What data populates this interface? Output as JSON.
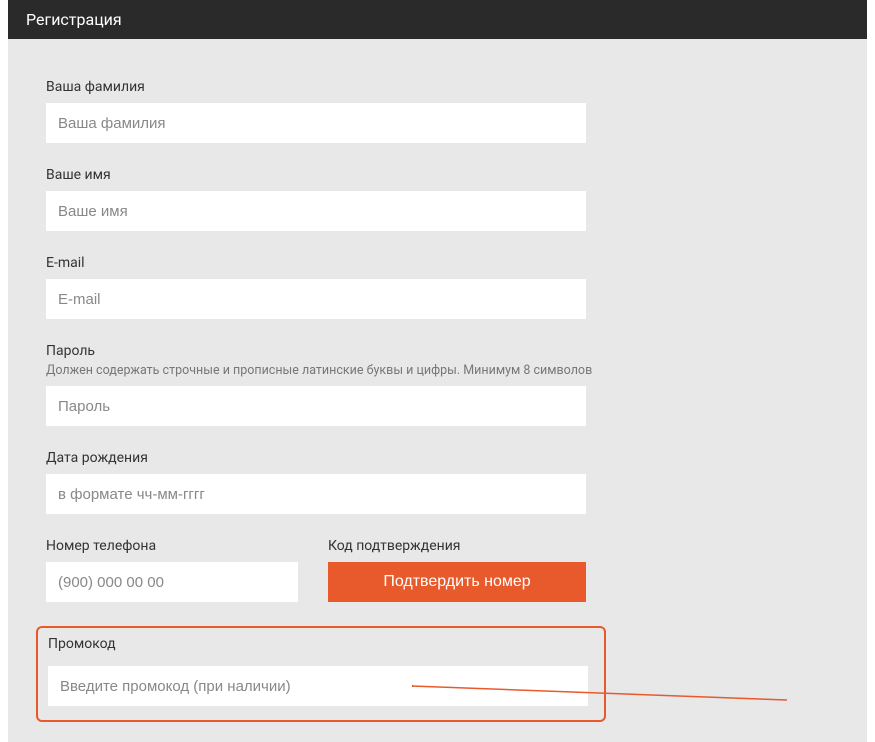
{
  "header": {
    "title": "Регистрация"
  },
  "form": {
    "last_name": {
      "label": "Ваша фамилия",
      "placeholder": "Ваша фамилия"
    },
    "first_name": {
      "label": "Ваше имя",
      "placeholder": "Ваше имя"
    },
    "email": {
      "label": "E-mail",
      "placeholder": "E-mail"
    },
    "password": {
      "label": "Пароль",
      "hint": "Должен содержать строчные и прописные латинские буквы и цифры. Минимум 8 символов",
      "placeholder": "Пароль"
    },
    "birthdate": {
      "label": "Дата рождения",
      "placeholder": "в формате чч-мм-гггг"
    },
    "phone": {
      "label": "Номер телефона",
      "placeholder": "(900) 000 00 00"
    },
    "verification": {
      "label": "Код подтверждения",
      "button": "Подтвердить номер"
    },
    "promo": {
      "label": "Промокод",
      "placeholder": "Введите промокод (при наличии)"
    }
  },
  "colors": {
    "accent": "#e85a2b",
    "header_bg": "#2a2a2a",
    "form_bg": "#e8e8e8"
  }
}
